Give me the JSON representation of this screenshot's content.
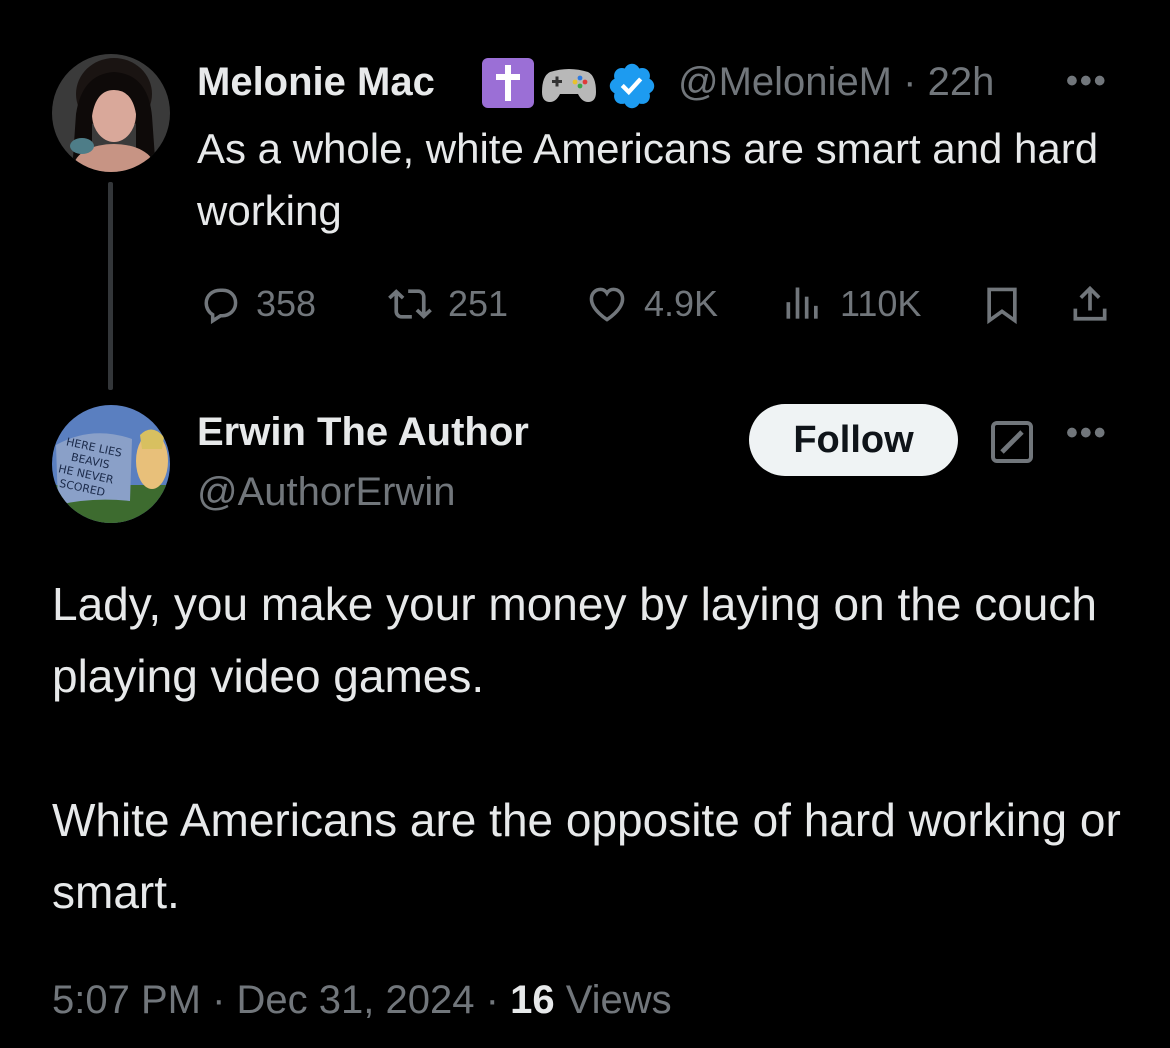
{
  "parent_tweet": {
    "author_name": "Melonie Mac",
    "badges": [
      "cross-icon",
      "gamepad-icon",
      "verified-icon"
    ],
    "handle": "@MelonieM",
    "separator": "·",
    "time_ago": "22h",
    "text": "As a whole, white Americans are smart and hard working",
    "actions": {
      "replies": "358",
      "retweets": "251",
      "likes": "4.9K",
      "views": "110K"
    }
  },
  "reply_tweet": {
    "author_name": "Erwin The Author",
    "handle": "@AuthorErwin",
    "follow_label": "Follow",
    "paragraphs": [
      "Lady, you make your money by laying on the couch playing video games.",
      "White Americans are the opposite of hard working or smart."
    ],
    "time": "5:07 PM",
    "date": "Dec 31, 2024",
    "separator": "·",
    "views_count": "16",
    "views_label": "Views"
  },
  "colors": {
    "background": "#000000",
    "text_primary": "#e7e9ea",
    "text_secondary": "#71767b",
    "verified": "#1d9bf0",
    "cross_badge": "#9b6fd6",
    "follow_bg": "#eff3f4"
  }
}
